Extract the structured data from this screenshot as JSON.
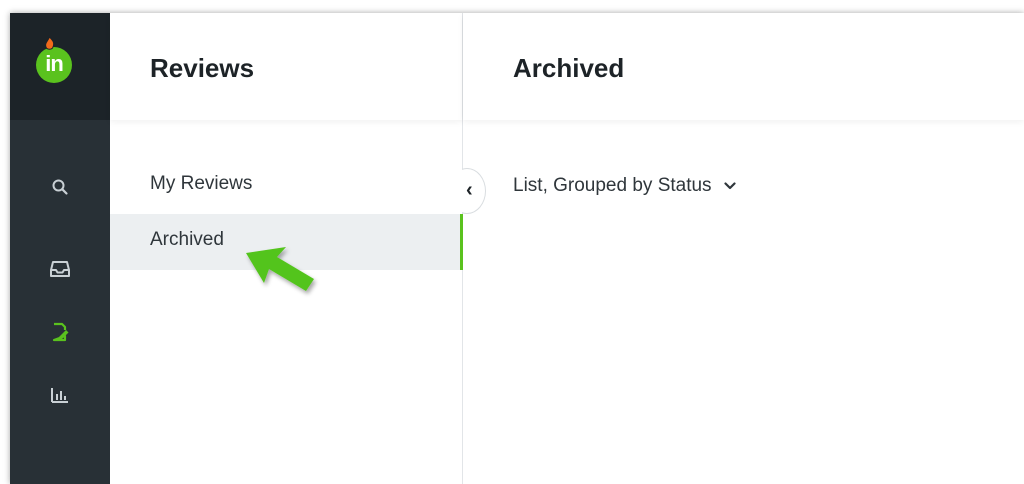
{
  "app": {
    "logo_text": "in"
  },
  "rail": {
    "icons": [
      "search-icon",
      "inbox-icon",
      "reviews-icon",
      "reports-icon"
    ],
    "active": "reviews-icon",
    "accent": "#5ac21e"
  },
  "sidebar": {
    "title": "Reviews",
    "items": [
      {
        "label": "My Reviews"
      },
      {
        "label": "Archived",
        "active": true
      }
    ]
  },
  "main": {
    "title": "Archived",
    "view_selector": "List, Grouped by Status"
  }
}
